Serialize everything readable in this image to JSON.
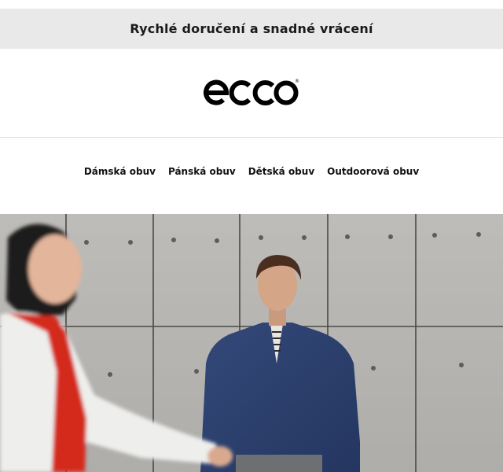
{
  "promo": {
    "text": "Rychlé doručení a snadné vrácení"
  },
  "brand": {
    "logo_text": "ecco",
    "registered_mark": "®"
  },
  "nav": {
    "items": [
      {
        "label": "Dámská obuv"
      },
      {
        "label": "Pánská obuv"
      },
      {
        "label": "Dětská obuv"
      },
      {
        "label": "Outdoorová obuv"
      }
    ]
  },
  "hero": {
    "description_colors": {
      "wall": "#b9b8b5",
      "shirt": "#2e4270",
      "jacket_red": "#d42a1f",
      "jacket_white": "#eeeeec"
    }
  }
}
